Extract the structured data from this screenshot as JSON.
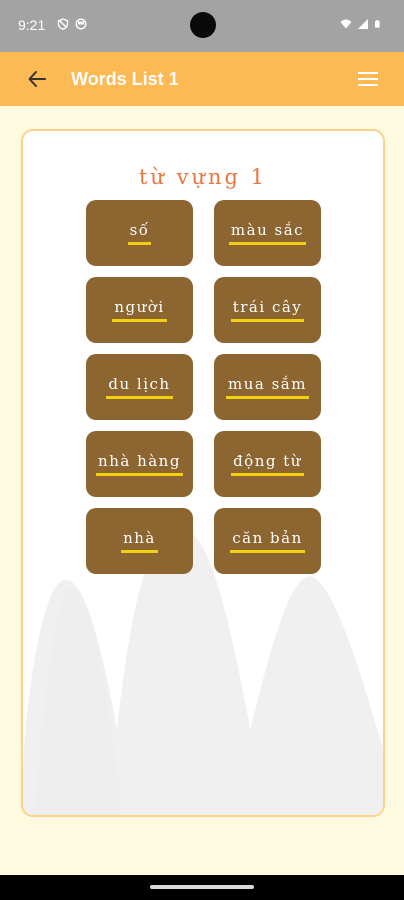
{
  "status_bar": {
    "time": "9:21",
    "left_icons": [
      "vpn-shield-icon",
      "lens-icon"
    ],
    "right_icons": [
      "wifi-icon",
      "signal-icon",
      "battery-icon"
    ]
  },
  "app_bar": {
    "title": "Words List 1",
    "back_icon": "arrow-left-icon",
    "menu_icon": "hamburger-menu-icon",
    "color": "#fdb953"
  },
  "list": {
    "heading": "từ vựng 1",
    "words": [
      {
        "label": "số"
      },
      {
        "label": "màu sắc"
      },
      {
        "label": "người"
      },
      {
        "label": "trái cây"
      },
      {
        "label": "du lịch"
      },
      {
        "label": "mua sắm"
      },
      {
        "label": "nhà hàng"
      },
      {
        "label": "động từ"
      },
      {
        "label": "nhà"
      },
      {
        "label": "căn bản"
      }
    ],
    "button_color": "#8c6530",
    "underline_color": "#f3cf12"
  }
}
